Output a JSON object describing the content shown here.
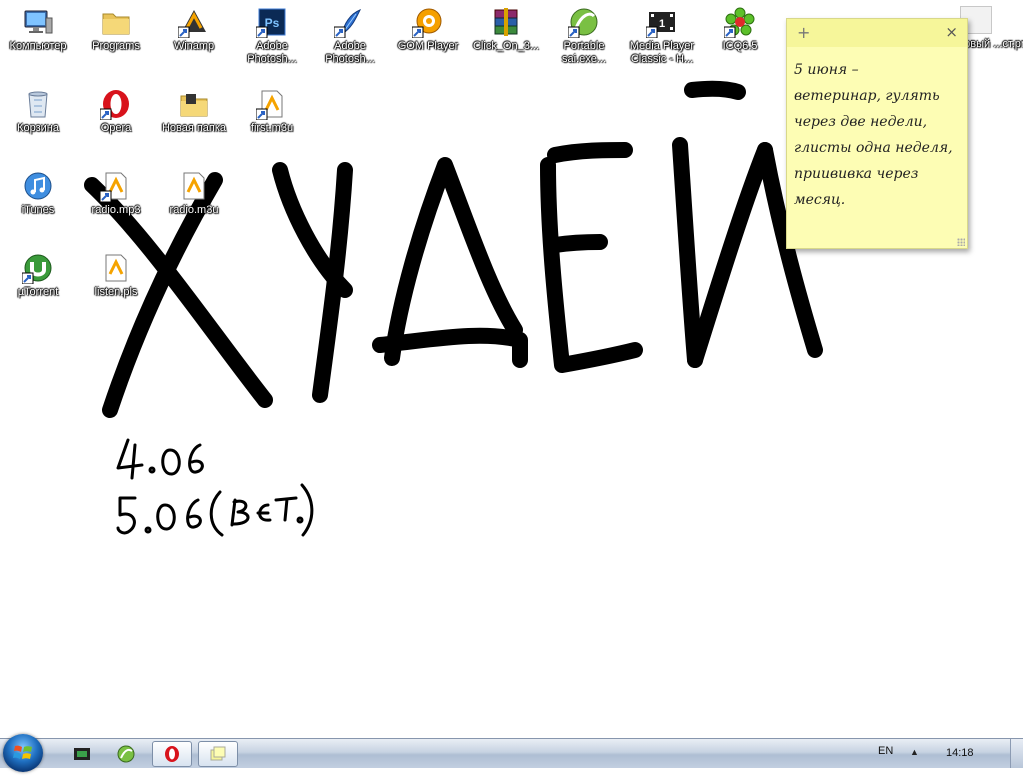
{
  "desktop": {
    "icons": [
      {
        "label": "Компьютер",
        "icon": "computer-icon"
      },
      {
        "label": "Programs",
        "icon": "folder-icon"
      },
      {
        "label": "Winamp",
        "icon": "winamp-icon"
      },
      {
        "label": "Adobe Photosh...",
        "icon": "photoshop-icon"
      },
      {
        "label": "Adobe Photosh...",
        "icon": "photoshop-feather-icon"
      },
      {
        "label": "GOM Player",
        "icon": "gom-player-icon"
      },
      {
        "label": "Click_On_3...",
        "icon": "winrar-archive-icon"
      },
      {
        "label": "Portable sai.exe...",
        "icon": "sai-icon"
      },
      {
        "label": "Media Player Classic - H...",
        "icon": "media-player-classic-icon"
      },
      {
        "label": "ICQ6.5",
        "icon": "icq-icon"
      },
      {
        "label": "Корзина",
        "icon": "recycle-bin-icon"
      },
      {
        "label": "Opera",
        "icon": "opera-icon"
      },
      {
        "label": "Новая папка",
        "icon": "folder-icon"
      },
      {
        "label": "first.m3u",
        "icon": "playlist-file-icon"
      },
      {
        "label": "iTunes",
        "icon": "itunes-icon"
      },
      {
        "label": "radio.mp3",
        "icon": "playlist-file-icon"
      },
      {
        "label": "radio.m3u",
        "icon": "playlist-file-icon"
      },
      {
        "label": "µTorrent",
        "icon": "utorrent-icon"
      },
      {
        "label": "listen.pls",
        "icon": "playlist-file-icon"
      }
    ],
    "partial_icon_label": "...овый ...ст.png",
    "drawing": {
      "big_text": "ХУДЕЙ",
      "line1": "4.06",
      "line2": "5.06 (вет.)"
    }
  },
  "sticky_note": {
    "add_symbol": "+",
    "close_symbol": "×",
    "text": "5 июня –\nветеринар, гулять\nчерез две недели,\nглисты одна неделя,\nприививка через\nмесяц.",
    "color": "#fdfdb4"
  },
  "taskbar": {
    "language": "EN",
    "tray_arrow": "▲",
    "clock": "14:18",
    "pinned": [
      {
        "icon": "media-player-classic-taskbar-icon"
      },
      {
        "icon": "sai-taskbar-icon"
      },
      {
        "icon": "opera-taskbar-icon"
      },
      {
        "icon": "sticky-notes-taskbar-icon"
      }
    ]
  }
}
